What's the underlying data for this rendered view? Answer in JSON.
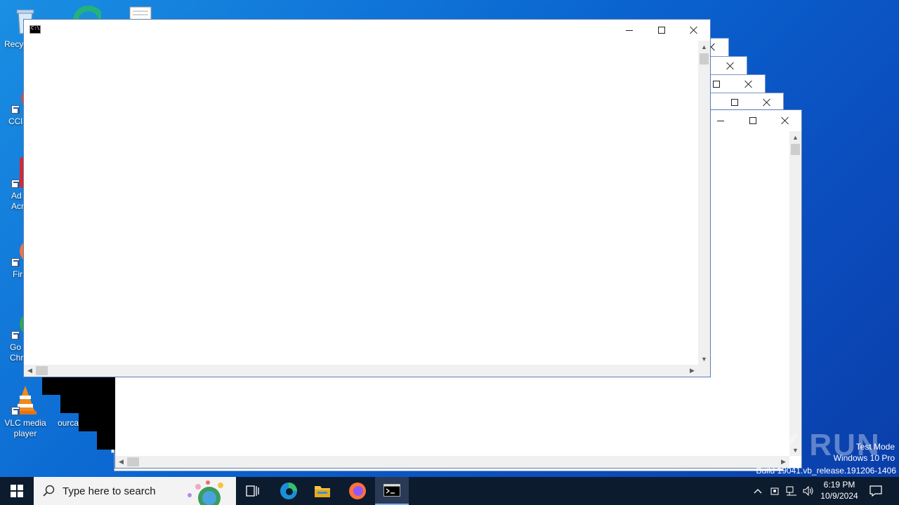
{
  "desktop": {
    "icons": [
      {
        "label": "Recy"
      },
      {
        "label": "CCl"
      },
      {
        "label": "Ad\nAcr"
      },
      {
        "label": "Fir"
      },
      {
        "label": "Go\nChr"
      },
      {
        "label": "VLC media\nplayer"
      },
      {
        "label": "ourca"
      }
    ]
  },
  "watermark": {
    "brand": "ANY RUN",
    "test_mode": "Test Mode",
    "edition": "Windows 10 Pro",
    "build": "Build 19041.vb_release.191206-1406"
  },
  "taskbar": {
    "search_placeholder": "Type here to search",
    "time": "6:19 PM",
    "date": "10/9/2024"
  },
  "colors": {
    "desktop_blue": "#0a64d0",
    "taskbar": "#0d1b2e",
    "window_border": "#5a7fb5"
  }
}
